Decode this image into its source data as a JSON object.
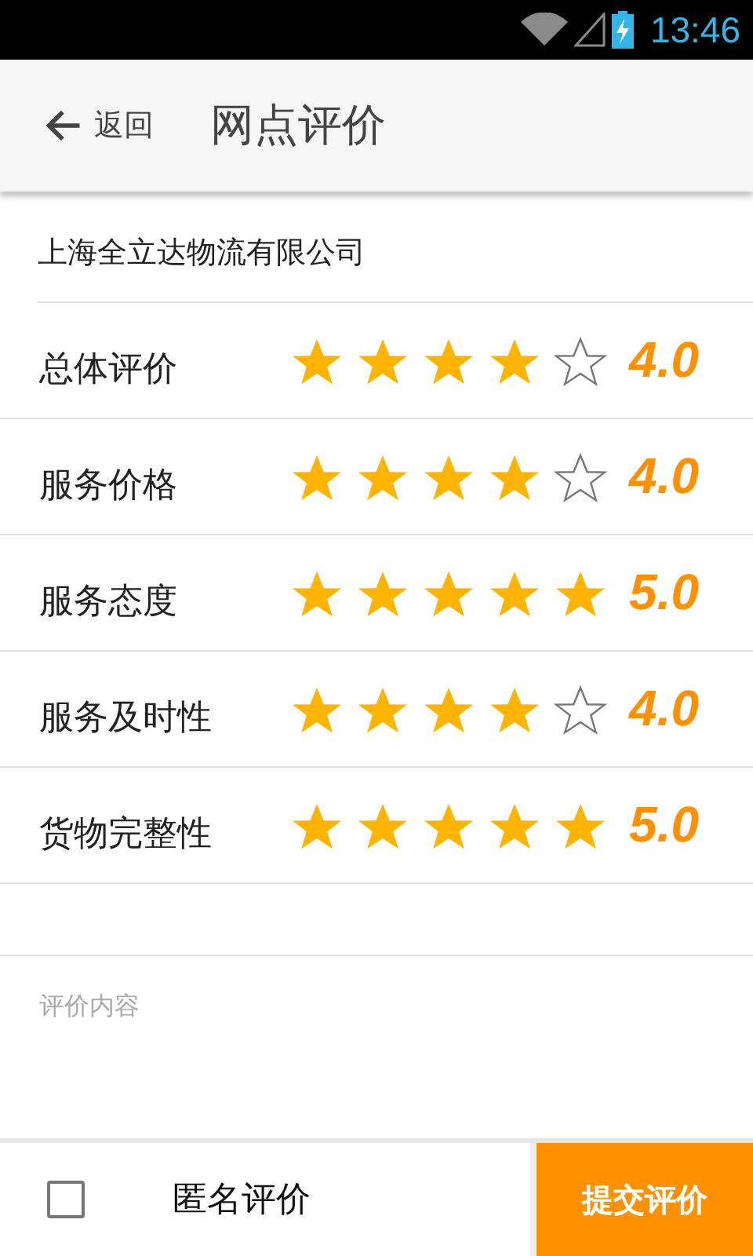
{
  "status_bar": {
    "time": "13:46"
  },
  "header": {
    "back_label": "返回",
    "title": "网点评价"
  },
  "company": "上海全立达物流有限公司",
  "ratings": [
    {
      "label": "总体评价",
      "stars": 4,
      "score": "4.0"
    },
    {
      "label": "服务价格",
      "stars": 4,
      "score": "4.0"
    },
    {
      "label": "服务态度",
      "stars": 5,
      "score": "5.0"
    },
    {
      "label": "服务及时性",
      "stars": 4,
      "score": "4.0"
    },
    {
      "label": "货物完整性",
      "stars": 5,
      "score": "5.0"
    }
  ],
  "comment": {
    "placeholder": "评价内容"
  },
  "footer": {
    "anonymous": {
      "label": "匿名评价",
      "checked": false
    },
    "submit": "提交评价"
  }
}
